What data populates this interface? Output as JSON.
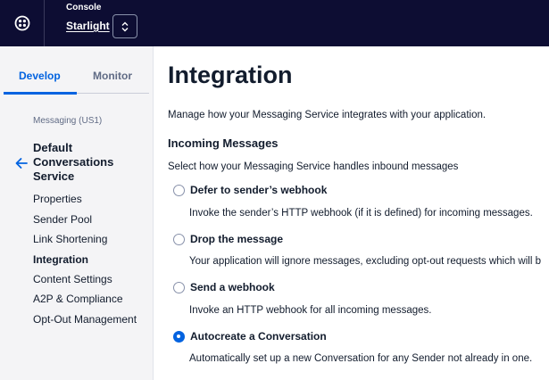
{
  "header": {
    "console_label": "Console",
    "account_name": "Starlight",
    "logo_icon": "twilio-logo-icon",
    "switch_icon": "chevron-up-down-icon"
  },
  "sidebar": {
    "tabs": [
      {
        "label": "Develop",
        "active": true
      },
      {
        "label": "Monitor",
        "active": false
      }
    ],
    "service_scope": "Messaging (US1)",
    "service_name": "Default Conversations Service",
    "back_icon": "arrow-left-icon",
    "items": [
      {
        "label": "Properties"
      },
      {
        "label": "Sender Pool"
      },
      {
        "label": "Link Shortening"
      },
      {
        "label": "Integration",
        "active": true
      },
      {
        "label": "Content Settings"
      },
      {
        "label": "A2P & Compliance"
      },
      {
        "label": "Opt-Out Management"
      }
    ]
  },
  "main": {
    "title": "Integration",
    "description": "Manage how your Messaging Service integrates with your application.",
    "incoming": {
      "title": "Incoming Messages",
      "description": "Select how your Messaging Service handles inbound messages",
      "options": [
        {
          "label": "Defer to sender’s webhook",
          "help": "Invoke the sender’s HTTP webhook (if it is defined) for incoming messages.",
          "selected": false
        },
        {
          "label": "Drop the message",
          "help": "Your application will ignore messages, excluding opt-out requests which will b",
          "selected": false
        },
        {
          "label": "Send a webhook",
          "help": "Invoke an HTTP webhook for all incoming messages.",
          "selected": false
        },
        {
          "label": "Autocreate a Conversation",
          "help": "Automatically set up a new Conversation for any Sender not already in one.",
          "selected": true
        }
      ]
    }
  },
  "colors": {
    "topbar": "#0d0d33",
    "accent": "#0263e0",
    "sidebar_bg": "#f4f4f6"
  }
}
